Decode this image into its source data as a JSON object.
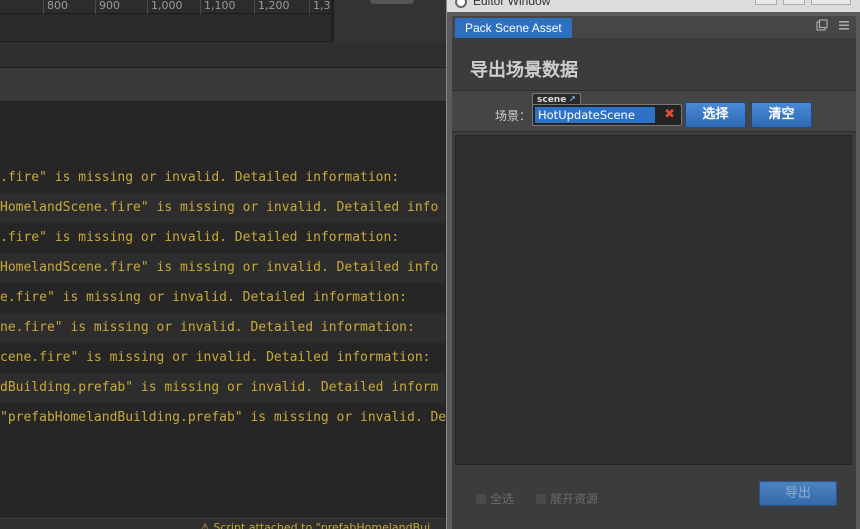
{
  "background": {
    "ruler_ticks": [
      "800",
      "900",
      "1,000",
      "1,100",
      "1,200",
      "1,3"
    ],
    "console_lines": [
      ".fire\" is missing or invalid. Detailed information:",
      "HomelandScene.fire\" is missing or invalid. Detailed info",
      ".fire\" is missing or invalid. Detailed information:",
      "HomelandScene.fire\" is missing or invalid. Detailed info",
      "e.fire\" is missing or invalid. Detailed information:",
      "ne.fire\" is missing or invalid. Detailed information:",
      "cene.fire\" is missing or invalid. Detailed information:",
      "dBuilding.prefab\" is missing or invalid. Detailed inform",
      "\"prefabHomelandBuilding.prefab\" is missing or invalid. De"
    ],
    "status_text": "⚠ Script attached to \"prefabHomelandBui"
  },
  "window": {
    "title": "Editor Window",
    "tab_label": "Pack Scene Asset",
    "panel_title": "导出场景数据",
    "scene_field": {
      "label": "场景：",
      "type_tag": "scene",
      "value": "HotUpdateScene"
    },
    "buttons": {
      "select": "选择",
      "clear": "清空",
      "export": "导出"
    },
    "checkboxes": {
      "select_all": "全选",
      "expand_assets": "展开资源"
    },
    "colors": {
      "accent": "#2e6fbf",
      "console_warning": "#c9a93a",
      "remove": "#e04a3a"
    }
  }
}
